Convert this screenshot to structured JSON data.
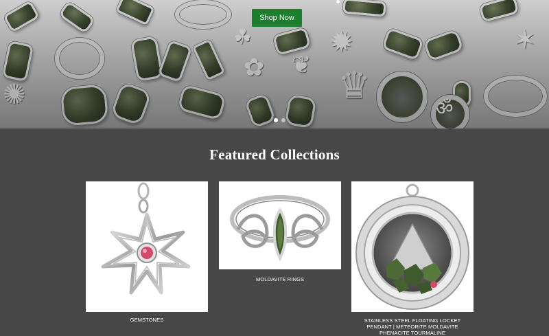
{
  "hero": {
    "shop_now_label": "Shop Now",
    "slides": [
      "slide-1",
      "slide-2"
    ],
    "active_slide": 1
  },
  "featured": {
    "title": "Featured Collections",
    "collections": [
      {
        "label": "GEMSTONES"
      },
      {
        "label": "MOLDAVITE RINGS"
      },
      {
        "label": "STAINLESS STEEL FLOATING LOCKET PENDANT | METEORITE MOLDAVITE PHENACITE TOURMALINE"
      }
    ]
  },
  "colors": {
    "page_background": "#474747",
    "accent_button": "#1c7f2d",
    "text": "#ffffff",
    "gem_green": "#3e4a32",
    "gem_pink": "#d14a6a",
    "silver": "#d3d3d3"
  }
}
